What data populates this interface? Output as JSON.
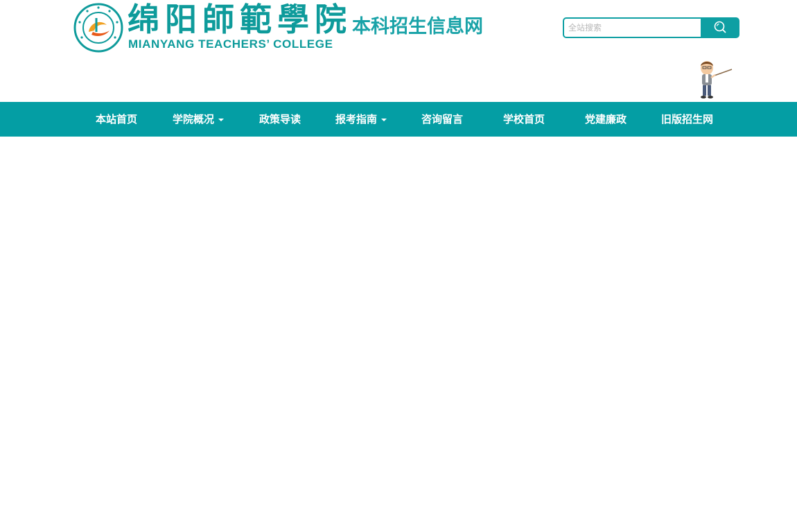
{
  "header": {
    "logo_cn": "绵阳師範學院",
    "logo_en": "MIANYANG TEACHERS’ COLLEGE",
    "site_title": "本科招生信息网"
  },
  "search": {
    "placeholder": "全站搜索",
    "value": ""
  },
  "nav": {
    "items": [
      {
        "label": "本站首页",
        "has_dropdown": false
      },
      {
        "label": "学院概况",
        "has_dropdown": true
      },
      {
        "label": "政策导读",
        "has_dropdown": false
      },
      {
        "label": "报考指南",
        "has_dropdown": true
      },
      {
        "label": "咨询留言",
        "has_dropdown": false
      },
      {
        "label": "学校首页",
        "has_dropdown": false
      },
      {
        "label": "党建廉政",
        "has_dropdown": false
      },
      {
        "label": "旧版招生网",
        "has_dropdown": false
      }
    ]
  },
  "colors": {
    "brand_teal": "#049ea4",
    "logo_teal": "#0e9b9b",
    "seal_orange": "#f0a020"
  },
  "icons": {
    "search": "search-icon",
    "mascot": "teacher-mascot-icon",
    "seal": "college-seal-logo"
  }
}
